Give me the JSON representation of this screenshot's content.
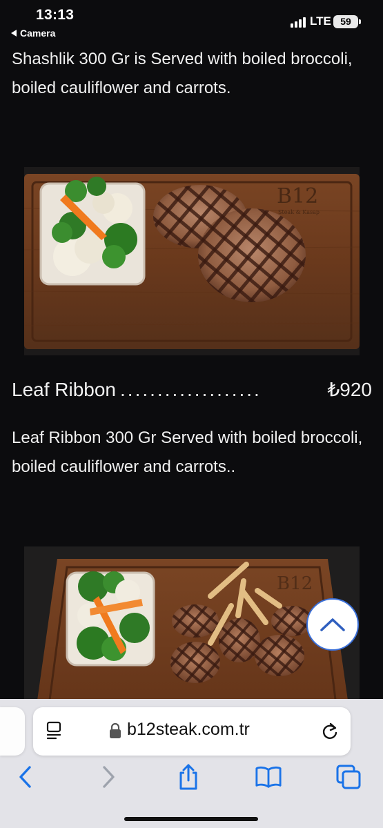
{
  "status_bar": {
    "time": "13:13",
    "back_label": "Camera",
    "network": "LTE",
    "battery": "59"
  },
  "menu": {
    "item0_description": "Shashlik 300 Gr is Served with boiled broccoli, boiled cauliflower and carrots.",
    "item1": {
      "name": "Leaf Ribbon",
      "dots": "...................",
      "price": "₺920",
      "description": "Leaf Ribbon 300 Gr Served with boiled broccoli, boiled cauliflower and carrots.."
    },
    "photo1_logo": "B12",
    "photo1_logo_sub": "Steak & Kasap",
    "photo2_logo": "B12"
  },
  "browser": {
    "url": "b12steak.com.tr"
  },
  "colors": {
    "background": "#0c0c0e",
    "accent": "#1a73e8",
    "wood": "#6b3a1f"
  },
  "icons": {
    "scroll_top": "chevron-up-icon",
    "reader": "reader-icon",
    "lock": "lock-icon",
    "reload": "reload-icon",
    "back": "back-arrow-icon",
    "forward": "forward-arrow-icon",
    "share": "share-icon",
    "bookmarks": "bookmarks-icon",
    "tabs": "tabs-icon"
  }
}
